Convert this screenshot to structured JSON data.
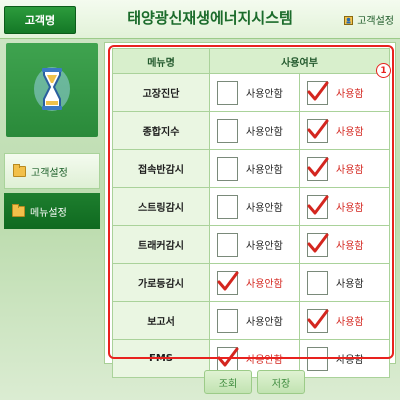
{
  "header": {
    "customer_button": "고객명",
    "title": "태양광신재생에너지시스템",
    "settings_link": "고객설정"
  },
  "sidebar": {
    "items": [
      {
        "label": "고객설정"
      },
      {
        "label": "메뉴설정"
      }
    ]
  },
  "table": {
    "col_menu": "메뉴명",
    "col_usage": "사용여부",
    "badge": "1",
    "label_unused": "사용안함",
    "label_used": "사용함",
    "rows": [
      {
        "name": "고장진단",
        "selected": "used"
      },
      {
        "name": "종합지수",
        "selected": "used"
      },
      {
        "name": "접속반감시",
        "selected": "used"
      },
      {
        "name": "스트링감시",
        "selected": "used"
      },
      {
        "name": "트래커감시",
        "selected": "used"
      },
      {
        "name": "가로등감시",
        "selected": "unused"
      },
      {
        "name": "보고서",
        "selected": "used"
      },
      {
        "name": "FMS",
        "selected": "unused"
      }
    ]
  },
  "buttons": {
    "search": "조회",
    "save": "저장"
  },
  "colors": {
    "accent_green": "#147826",
    "highlight_red": "#e8221e",
    "check_red": "#d4261f"
  }
}
